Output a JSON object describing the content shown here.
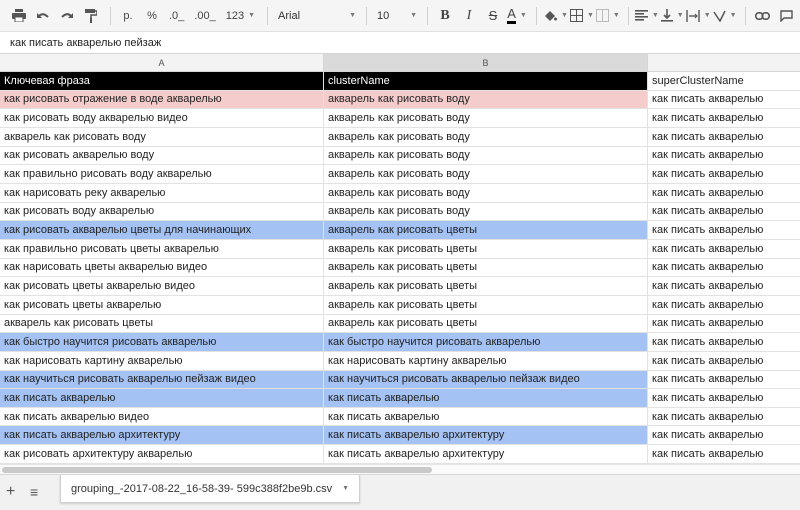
{
  "toolbar": {
    "format_ruble": "р.",
    "format_percent": "%",
    "format_dec_decrease": ".0_",
    "format_dec_increase": ".00_",
    "format_more": "123",
    "font_family": "Arial",
    "font_size": "10",
    "bold": "B",
    "italic": "I",
    "strike": "S",
    "text_color": "A"
  },
  "formula_bar": {
    "value": "как писать акварелью пейзаж"
  },
  "columns": [
    "A",
    "B"
  ],
  "table": {
    "headers": [
      "Ключевая фраза",
      "clusterName",
      "superClusterName"
    ],
    "rows": [
      {
        "keyword": "как рисовать отражение в воде акварелью",
        "cluster": "акварель как рисовать воду",
        "super": "как писать акварелью",
        "highlight": "pink"
      },
      {
        "keyword": "как рисовать воду акварелью видео",
        "cluster": "акварель как рисовать воду",
        "super": "как писать акварелью",
        "highlight": ""
      },
      {
        "keyword": "акварель как рисовать воду",
        "cluster": "акварель как рисовать воду",
        "super": "как писать акварелью",
        "highlight": ""
      },
      {
        "keyword": "как рисовать акварелью воду",
        "cluster": "акварель как рисовать воду",
        "super": "как писать акварелью",
        "highlight": ""
      },
      {
        "keyword": "как правильно рисовать воду акварелью",
        "cluster": "акварель как рисовать воду",
        "super": "как писать акварелью",
        "highlight": ""
      },
      {
        "keyword": "как нарисовать реку акварелью",
        "cluster": "акварель как рисовать воду",
        "super": "как писать акварелью",
        "highlight": ""
      },
      {
        "keyword": "как рисовать воду акварелью",
        "cluster": "акварель как рисовать воду",
        "super": "как писать акварелью",
        "highlight": ""
      },
      {
        "keyword": "как рисовать акварелью цветы для начинающих",
        "cluster": "акварель как рисовать цветы",
        "super": "как писать акварелью",
        "highlight": "blue"
      },
      {
        "keyword": "как правильно рисовать цветы акварелью",
        "cluster": "акварель как рисовать цветы",
        "super": "как писать акварелью",
        "highlight": ""
      },
      {
        "keyword": "как нарисовать цветы акварелью видео",
        "cluster": "акварель как рисовать цветы",
        "super": "как писать акварелью",
        "highlight": ""
      },
      {
        "keyword": "как рисовать цветы акварелью видео",
        "cluster": "акварель как рисовать цветы",
        "super": "как писать акварелью",
        "highlight": ""
      },
      {
        "keyword": "как рисовать цветы акварелью",
        "cluster": "акварель как рисовать цветы",
        "super": "как писать акварелью",
        "highlight": ""
      },
      {
        "keyword": "акварель как рисовать цветы",
        "cluster": "акварель как рисовать цветы",
        "super": "как писать акварелью",
        "highlight": ""
      },
      {
        "keyword": "как быстро научится рисовать акварелью",
        "cluster": "как быстро научится рисовать акварелью",
        "super": "как писать акварелью",
        "highlight": "blue"
      },
      {
        "keyword": "как нарисовать картину акварелью",
        "cluster": "как нарисовать картину акварелью",
        "super": "как писать акварелью",
        "highlight": ""
      },
      {
        "keyword": "как научиться рисовать акварелью пейзаж видео",
        "cluster": "как научиться рисовать акварелью пейзаж видео",
        "super": "как писать акварелью",
        "highlight": "blue"
      },
      {
        "keyword": "как писать акварелью",
        "cluster": "как писать акварелью",
        "super": "как писать акварелью",
        "highlight": "blue"
      },
      {
        "keyword": "как писать акварелью видео",
        "cluster": "как писать акварелью",
        "super": "как писать акварелью",
        "highlight": ""
      },
      {
        "keyword": "как писать акварелью архитектуру",
        "cluster": "как писать акварелью архитектуру",
        "super": "как писать акварелью",
        "highlight": "blue"
      },
      {
        "keyword": "как рисовать архитектуру акварелью",
        "cluster": "как писать акварелью архитектуру",
        "super": "как писать акварелью",
        "highlight": ""
      }
    ]
  },
  "colors": {
    "header_bg": "#000000",
    "pink": "#f4cccc",
    "blue": "#a4c2f4"
  },
  "sheet_tab": {
    "name": "grouping_-2017-08-22_16-58-39- 599c388f2be9b.csv"
  }
}
